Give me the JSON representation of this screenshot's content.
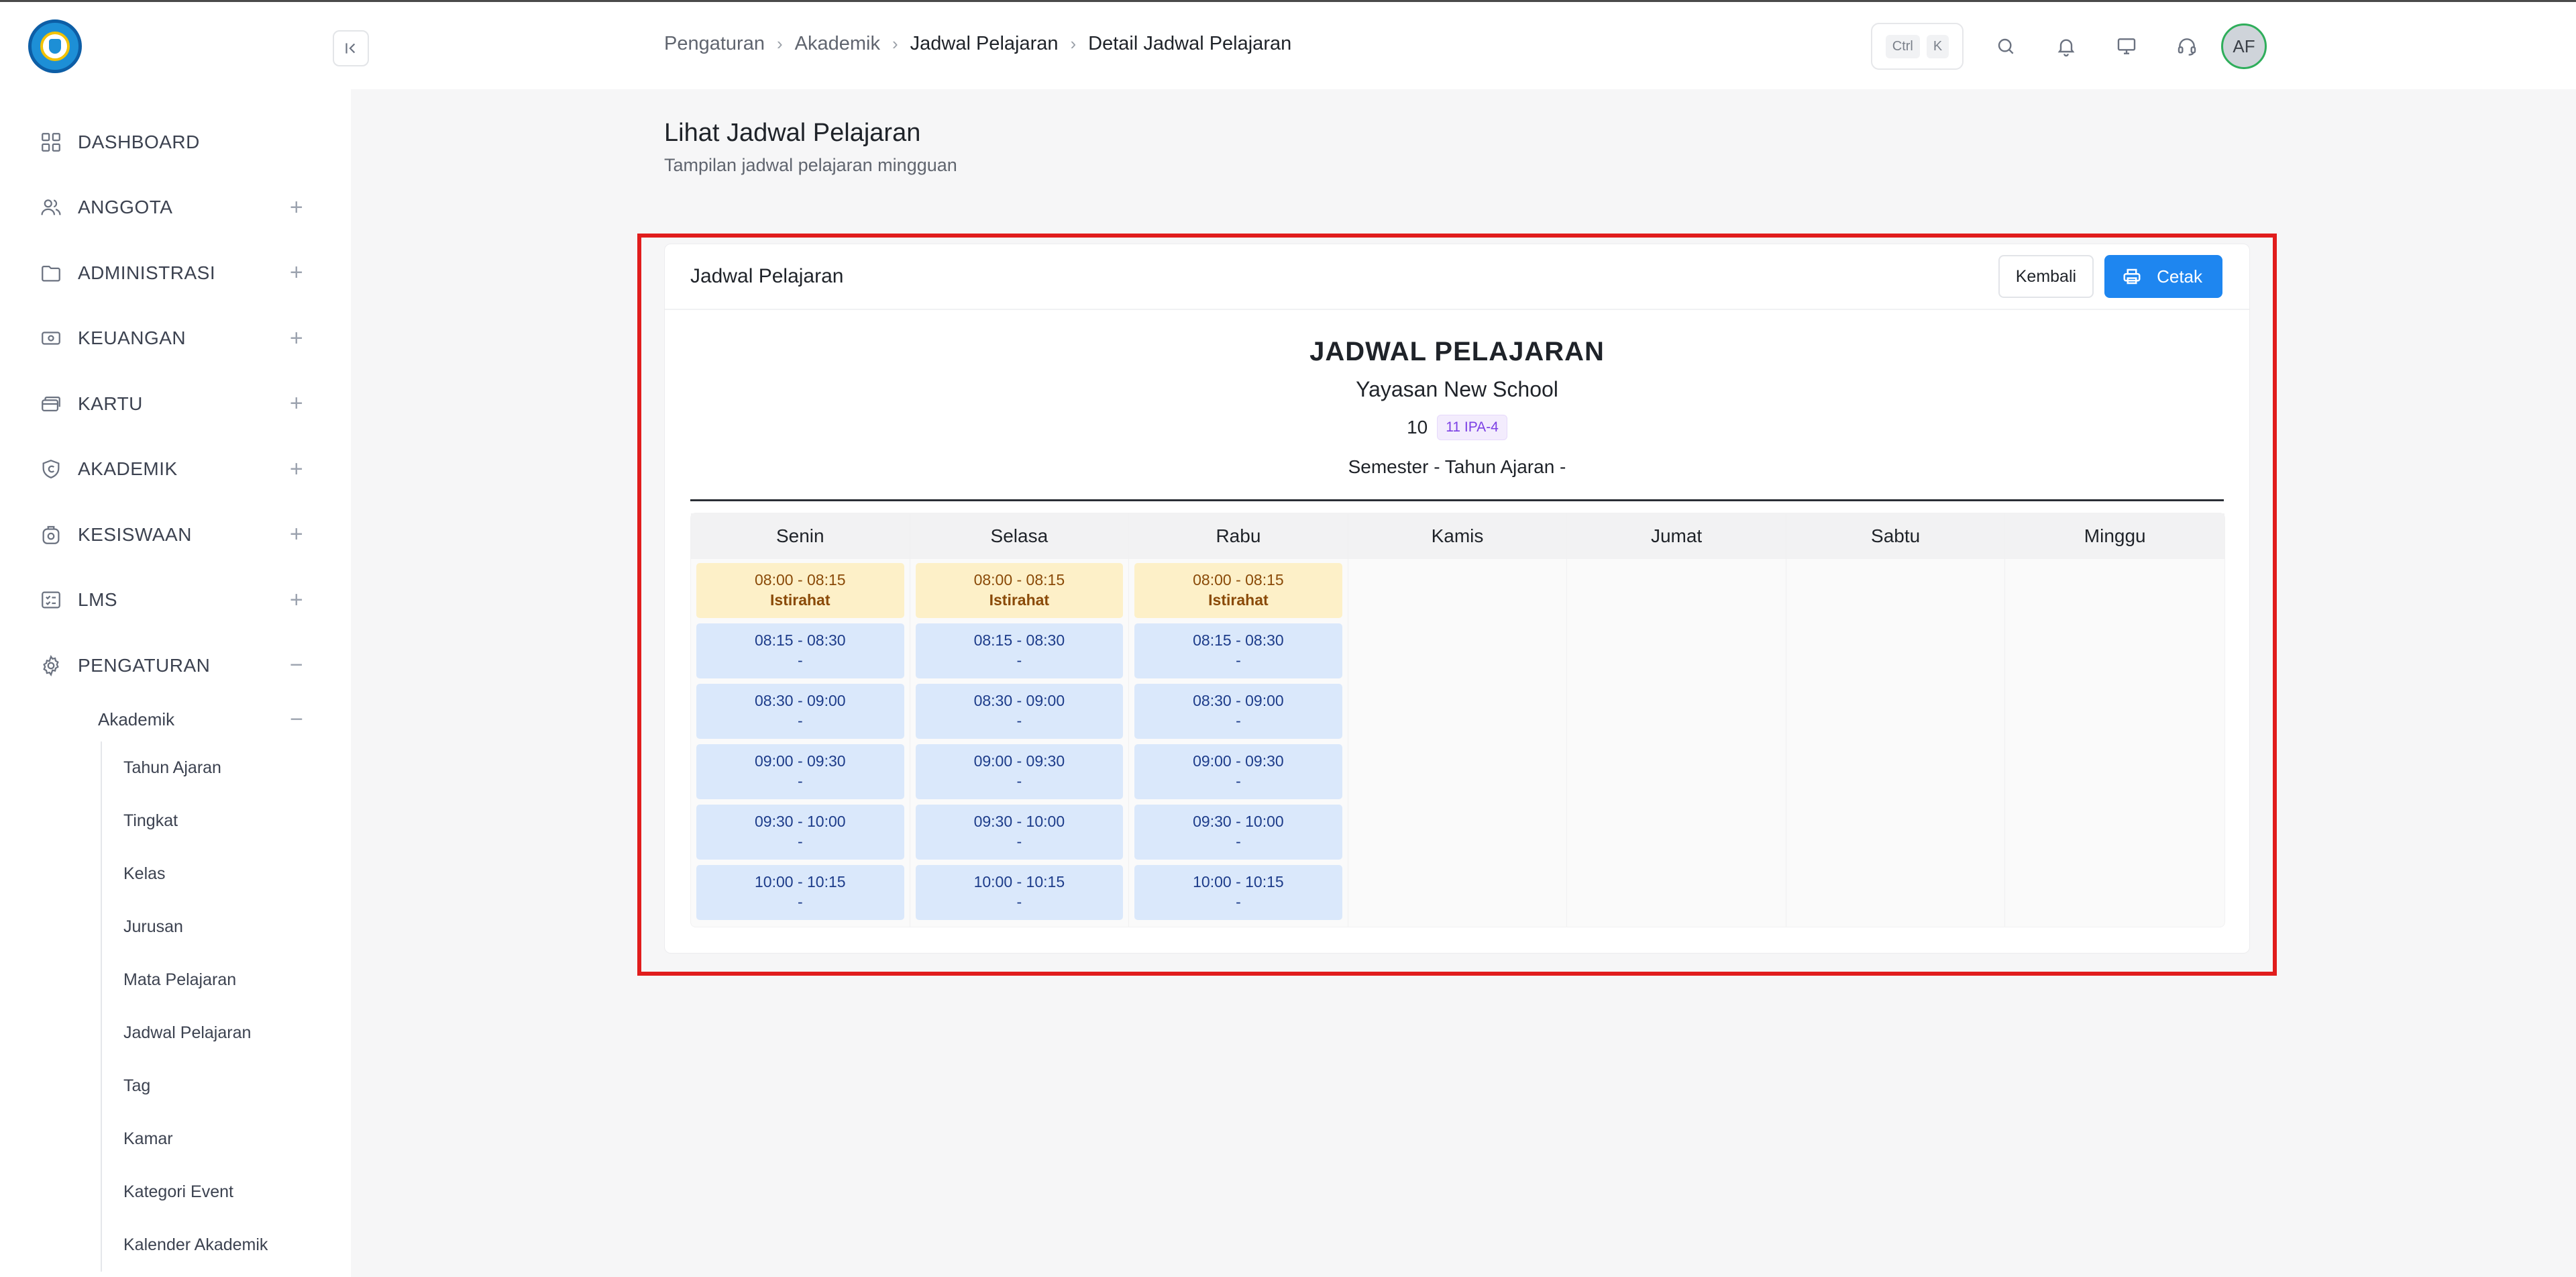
{
  "sidebar": {
    "items": [
      {
        "label": "DASHBOARD",
        "icon": "grid-icon",
        "expand": ""
      },
      {
        "label": "ANGGOTA",
        "icon": "users-icon",
        "expand": "+"
      },
      {
        "label": "ADMINISTRASI",
        "icon": "folder-icon",
        "expand": "+"
      },
      {
        "label": "KEUANGAN",
        "icon": "money-icon",
        "expand": "+"
      },
      {
        "label": "KARTU",
        "icon": "card-icon",
        "expand": "+"
      },
      {
        "label": "AKADEMIK",
        "icon": "academic-icon",
        "expand": "+"
      },
      {
        "label": "KESISWAAN",
        "icon": "student-icon",
        "expand": "+"
      },
      {
        "label": "LMS",
        "icon": "list-icon",
        "expand": "+"
      },
      {
        "label": "PENGATURAN",
        "icon": "gear-icon",
        "expand": "−"
      }
    ],
    "sub": {
      "label": "Akademik",
      "expand": "−"
    },
    "subsub": [
      "Tahun Ajaran",
      "Tingkat",
      "Kelas",
      "Jurusan",
      "Mata Pelajaran",
      "Jadwal Pelajaran",
      "Tag",
      "Kamar",
      "Kategori Event",
      "Kalender Akademik"
    ]
  },
  "breadcrumb": [
    "Pengaturan",
    "Akademik",
    "Jadwal Pelajaran",
    "Detail Jadwal Pelajaran"
  ],
  "topbar": {
    "kbd1": "Ctrl",
    "kbd2": "K",
    "avatar": "AF"
  },
  "page": {
    "title": "Lihat Jadwal Pelajaran",
    "subtitle": "Tampilan jadwal pelajaran mingguan"
  },
  "card": {
    "title": "Jadwal Pelajaran",
    "back_label": "Kembali",
    "print_label": "Cetak"
  },
  "schedule": {
    "title": "JADWAL PELAJARAN",
    "school": "Yayasan New School",
    "grade": "10",
    "class_badge": "11 IPA-4",
    "semester": "Semester - Tahun Ajaran -",
    "days": [
      "Senin",
      "Selasa",
      "Rabu",
      "Kamis",
      "Jumat",
      "Sabtu",
      "Minggu"
    ],
    "slots": [
      {
        "time": "08:00 - 08:15",
        "subject": "Istirahat",
        "type": "break"
      },
      {
        "time": "08:15 - 08:30",
        "subject": "-",
        "type": "lesson"
      },
      {
        "time": "08:30 - 09:00",
        "subject": "-",
        "type": "lesson"
      },
      {
        "time": "09:00 - 09:30",
        "subject": "-",
        "type": "lesson"
      },
      {
        "time": "09:30 - 10:00",
        "subject": "-",
        "type": "lesson"
      },
      {
        "time": "10:00 - 10:15",
        "subject": "-",
        "type": "lesson"
      }
    ],
    "days_with_slots": 3
  }
}
